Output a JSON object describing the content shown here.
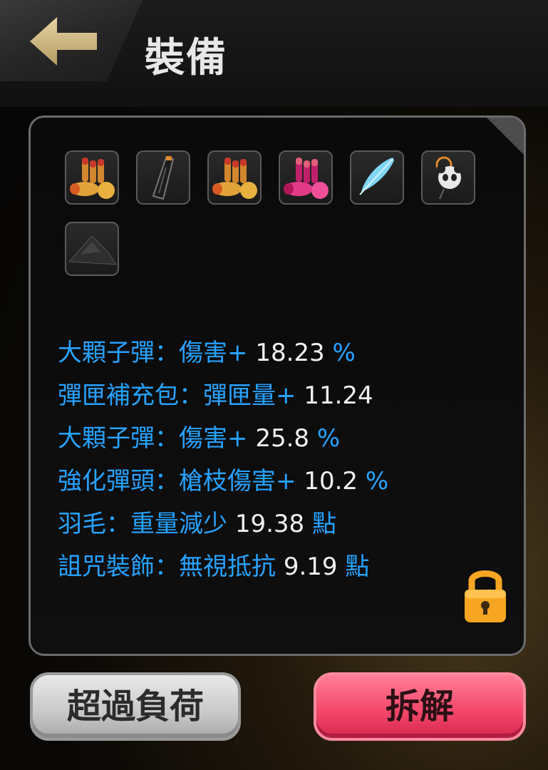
{
  "header": {
    "title": "裝備"
  },
  "equipment_slots": [
    {
      "item": "bullets-gold-icon"
    },
    {
      "item": "magazine-icon"
    },
    {
      "item": "bullets-gold-icon"
    },
    {
      "item": "bullets-pink-icon"
    },
    {
      "item": "feather-icon"
    },
    {
      "item": "panda-charm-icon"
    },
    {
      "item": "rock-shard-icon"
    }
  ],
  "stats": [
    {
      "label": "大顆子彈：傷害+",
      "value": "18.23",
      "unit": "%"
    },
    {
      "label": "彈匣補充包：彈匣量+",
      "value": "11.24",
      "unit": ""
    },
    {
      "label": "大顆子彈：傷害+",
      "value": "25.8",
      "unit": "%"
    },
    {
      "label": "強化彈頭：槍枝傷害+",
      "value": "10.2",
      "unit": "%"
    },
    {
      "label": "羽毛：重量減少",
      "value": "19.38",
      "unit": "點"
    },
    {
      "label": "詛咒裝飾：無視抵抗",
      "value": "9.19",
      "unit": "點"
    }
  ],
  "buttons": {
    "overload": "超過負荷",
    "dismantle": "拆解"
  },
  "colors": {
    "stat_label": "#27a2ff",
    "stat_value": "#f2f2f2",
    "dismantle_button": "#f4496c",
    "lock": "#f6a623"
  }
}
